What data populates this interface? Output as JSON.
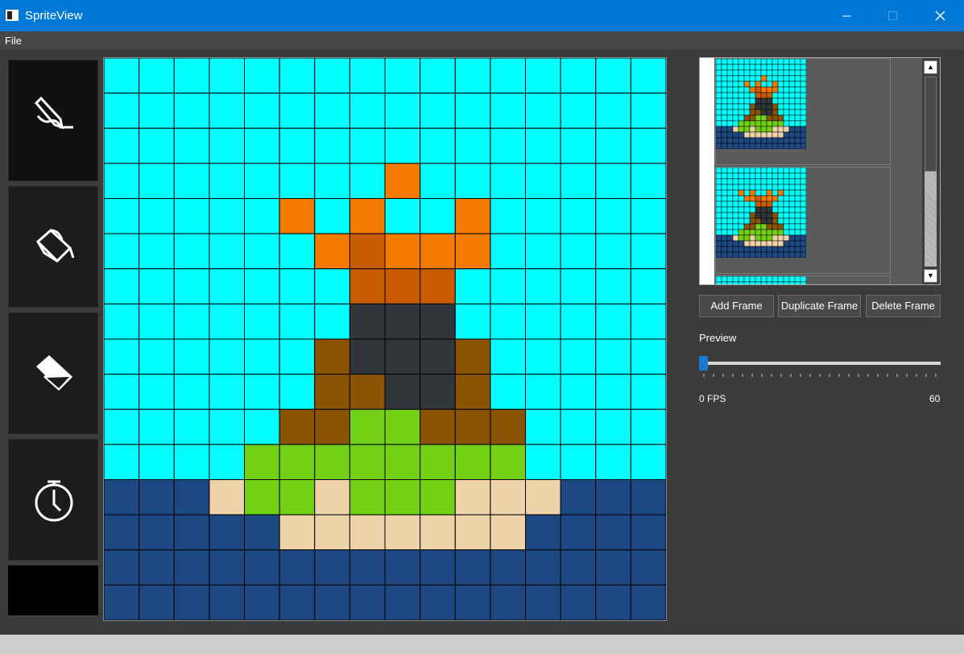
{
  "window": {
    "title": "SpriteView"
  },
  "menu": {
    "file": "File"
  },
  "tools": [
    {
      "name": "pencil",
      "icon": "pencil-icon"
    },
    {
      "name": "bucket",
      "icon": "paint-bucket-icon"
    },
    {
      "name": "eraser",
      "icon": "eraser-icon"
    },
    {
      "name": "timer",
      "icon": "stopwatch-icon"
    }
  ],
  "current_color": "#000000",
  "palette": {
    "A": "#00ffff",
    "O": "#f57b00",
    "D": "#c95c00",
    "G": "#30363a",
    "B": "#8b5405",
    "L": "#73d115",
    "N": "#1e4882",
    "S": "#edd2aa"
  },
  "sprite": [
    "AAAAAAAAAAAAAAAA",
    "AAAAAAAAAAAAAAAA",
    "AAAAAAAAAAAAAAAA",
    "AAAAAAAAOAAAAAAA",
    "AAAAAOAOAAOAAAAA",
    "AAAAAAODOOOAAAAA",
    "AAAAAAADDDAAAAAA",
    "AAAAAAAGGGAAAAAA",
    "AAAAAAB GGBAAAAA",
    "AAAAAABBGGBAAAAA",
    "AAAAABBLLBBBAAAA",
    "AAAALLLLLLLLAAAA",
    "NNNSLLSLLLSSSNNN",
    "NNNNNSSSSSSSNNNN",
    "NNNNNNNNNNNNNNNN",
    "NNNNNNNNNNNNNNNN"
  ],
  "frame_2_sprite": [
    "AAAAAAAAAAAAAAAA",
    "AAAAAAAAAAAAAAAA",
    "AAAAAAAAAAAAAAAA",
    "AAAAAAAAAAAAAAAA",
    "AAAAOAOAAOAOAAAA",
    "AAAAAOODOOOAAAAA",
    "AAAAAAADDDAAAAAA",
    "AAAAAAAGGGAAAAAA",
    "AAAAAAB GGBAAAAA",
    "AAAAAABBGGBAAAAA",
    "AAAAABBLLBBBAAAA",
    "AAAALLLLLLLLAAAA",
    "NNNSLLSLLLSSSNNN",
    "NNNNNSSSSSSSNNNN",
    "NNNNNNNNNNNNNNNN",
    "NNNNNNNNNNNNNNNN"
  ],
  "buttons": {
    "add": "Add Frame",
    "duplicate": "Duplicate Frame",
    "delete": "Delete Frame"
  },
  "preview": {
    "label": "Preview",
    "fps_value": 0,
    "min_label": "0 FPS",
    "max_label": "60"
  }
}
